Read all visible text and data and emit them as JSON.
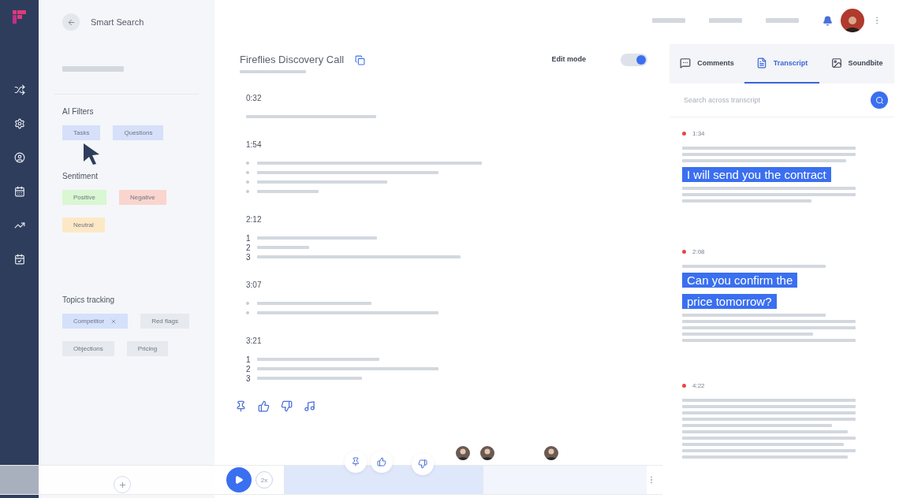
{
  "left_panel": {
    "title": "Smart Search",
    "sections": [
      {
        "title": "AI Filters",
        "chips": [
          {
            "label": "Tasks",
            "color": "#d6e0f9",
            "removable": false
          },
          {
            "label": "Questions",
            "color": "#d6e0f9",
            "removable": false
          }
        ]
      },
      {
        "title": "Sentiment",
        "chips": [
          {
            "label": "Positive",
            "color": "#d9f7d2",
            "removable": false
          },
          {
            "label": "Negative",
            "color": "#f9d5ce",
            "removable": false
          },
          {
            "label": "Neutral",
            "color": "#fde8c6",
            "removable": false
          }
        ]
      },
      {
        "title": "Topics tracking",
        "chips": [
          {
            "label": "Competitor",
            "color": "#d5e1fb",
            "removable": true
          },
          {
            "label": "Red flags",
            "color": "#e6e9ee",
            "removable": false
          },
          {
            "label": "Objections",
            "color": "#e6e9ee",
            "removable": false
          },
          {
            "label": "Pricing",
            "color": "#e6e9ee",
            "removable": false
          }
        ]
      }
    ]
  },
  "meeting": {
    "title": "Fireflies Discovery Call",
    "edit_mode": {
      "label": "Edit mode",
      "on": true
    },
    "blocks": [
      {
        "time": "0:32",
        "kind": "plain"
      },
      {
        "time": "1:54",
        "kind": "bullets"
      },
      {
        "time": "2:12",
        "kind": "numbered",
        "markers": [
          "1",
          "2",
          "3"
        ]
      },
      {
        "time": "3:07",
        "kind": "bullets"
      },
      {
        "time": "3:21",
        "kind": "numbered",
        "markers": [
          "1",
          "2",
          "3"
        ]
      }
    ]
  },
  "player": {
    "speed": "2x",
    "level": 0.55
  },
  "transcript_panel": {
    "tabs": [
      {
        "label": "Comments",
        "selected": false
      },
      {
        "label": "Transcript",
        "selected": true
      },
      {
        "label": "Soundbite",
        "selected": false
      }
    ],
    "search": {
      "placeholder": "Search across transcript"
    },
    "entries": [
      {
        "time": "1:34",
        "color": "#e84545",
        "highlight": [
          "I will send you the contract"
        ]
      },
      {
        "time": "2:08",
        "color": "#e84545",
        "highlight": [
          "Can you confirm the",
          "price tomorrow?"
        ]
      },
      {
        "time": "4:22",
        "color": "#e84545"
      }
    ]
  }
}
